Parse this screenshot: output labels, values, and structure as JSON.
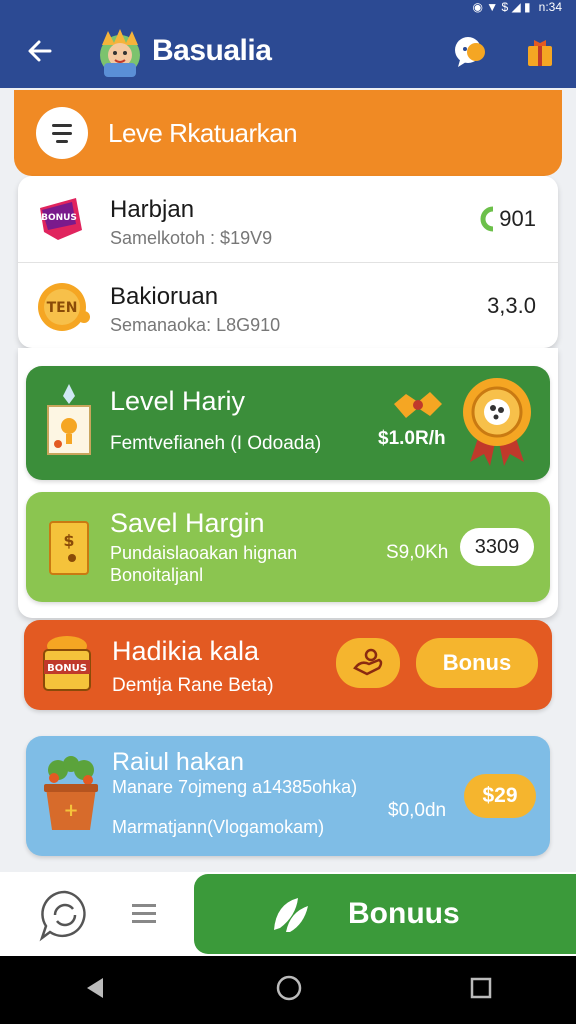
{
  "status_bar": {
    "time": "n:34"
  },
  "header": {
    "title": "Basualia"
  },
  "banner": {
    "title": "Leve Rkatuarkan"
  },
  "list": [
    {
      "title": "Harbjan",
      "subtitle": "Samelkotoh : $19V9",
      "value": "901",
      "icon": "ticket-icon"
    },
    {
      "title": "Bakioruan",
      "subtitle": "Semanaoka: L8G910",
      "value": "3,3.0",
      "icon": "coin-icon"
    }
  ],
  "cards": {
    "level": {
      "title": "Level Hariy",
      "subtitle": "Femtvefianeh (I Odoada)",
      "amount": "$1.0R/h",
      "color": "#3b8e3a"
    },
    "savel": {
      "title": "Savel Hargin",
      "subtitle_line1": "Pundaislaoakan hignan",
      "subtitle_line2": "Bonoitaljanl",
      "amount": "S9,0Kh",
      "badge": "3309",
      "color": "#8bc550"
    },
    "hadikia": {
      "title": "Hadikia kala",
      "subtitle": "Demtja Rane Beta)",
      "bonus_label": "Bonus",
      "color": "#e35a22"
    },
    "raiul": {
      "title": "Raiul hakan",
      "subtitle_line1": "Manare 7ojmeng a14385ohka)",
      "subtitle_line2": "Marmatjann(Vlogamokam)",
      "amount": "$0,0dn",
      "badge": "$29",
      "color": "#7fbde6"
    }
  },
  "bottom": {
    "bonus_label": "Bonuus"
  },
  "colors": {
    "primary": "#2c4a93",
    "orange": "#f08a24",
    "green": "#3b8e3a"
  }
}
